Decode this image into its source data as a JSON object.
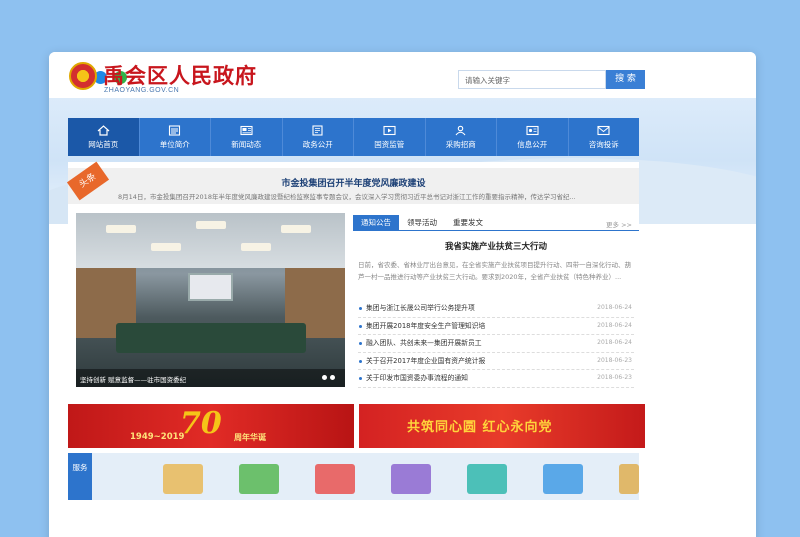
{
  "window": {
    "dots": [
      "red",
      "blue",
      "green"
    ]
  },
  "header": {
    "title": "禹会区人民政府",
    "subtitle": "ZHAOYANG.GOV.CN",
    "search_placeholder": "请输入关键字",
    "search_button": "搜 索"
  },
  "nav": {
    "items": [
      {
        "label": "网站首页",
        "icon": "home-icon"
      },
      {
        "label": "单位简介",
        "icon": "document-icon"
      },
      {
        "label": "新闻动态",
        "icon": "news-icon"
      },
      {
        "label": "政务公开",
        "icon": "book-icon"
      },
      {
        "label": "国资监管",
        "icon": "video-icon"
      },
      {
        "label": "采购招商",
        "icon": "people-icon"
      },
      {
        "label": "信息公开",
        "icon": "notice-icon"
      },
      {
        "label": "咨询投诉",
        "icon": "mail-icon"
      }
    ]
  },
  "headline": {
    "tag": "头条",
    "title": "市金投集团召开半年度党风廉政建设",
    "summary": "8月14日，市金投集团召开2018年半年度党风廉政建设暨纪检监察监事专题会议，会议深入学习贯彻习近平总书记对浙江工作的重要指示精神，传达学习省纪..."
  },
  "photo": {
    "caption": "坚持创新 赋意监督——驻市国资委纪"
  },
  "tabs": [
    {
      "label": "通知公告"
    },
    {
      "label": "领导活动"
    },
    {
      "label": "重要发文"
    }
  ],
  "more_label": "更多 >>",
  "notice": {
    "title": "我省实施产业扶贫三大行动",
    "text": "日前，省农委、省林业厅出台意见，在全省实施产业扶贫项目提升行动、四带一自深化行动、葫芦一村一品推进行动等产业扶贫三大行动。要求到2020年，全省产业扶贫（特色种养业）..."
  },
  "news_list": [
    {
      "title": "集团与浙江长晟公司举行公务提升项",
      "date": "2018-06-24"
    },
    {
      "title": "集团开展2018年度安全生产管理知识培",
      "date": "2018-06-24"
    },
    {
      "title": "融入团队、共创未来—集团开展新员工",
      "date": "2018-06-24"
    },
    {
      "title": "关于召开2017年度企业国有资产统计报",
      "date": "2018-06-23"
    },
    {
      "title": "关于印发市国资委办事流程的通知",
      "date": "2018-06-23"
    }
  ],
  "banners": {
    "left": {
      "years": "1949~2019",
      "number": "70",
      "slogan": "周年华诞"
    },
    "right": {
      "slogan": "共筑同心圆  红心永向党"
    }
  },
  "services": {
    "label": "服务",
    "icons": [
      {
        "name": "service-icon-1",
        "color": "#e8c170"
      },
      {
        "name": "service-icon-2",
        "color": "#6cc06c"
      },
      {
        "name": "service-icon-3",
        "color": "#e86a6a"
      },
      {
        "name": "service-icon-4",
        "color": "#9a7bd6"
      },
      {
        "name": "service-icon-5",
        "color": "#4cc0b8"
      },
      {
        "name": "service-icon-6",
        "color": "#5aa8e8"
      },
      {
        "name": "service-icon-7",
        "color": "#e0b86a"
      }
    ]
  }
}
